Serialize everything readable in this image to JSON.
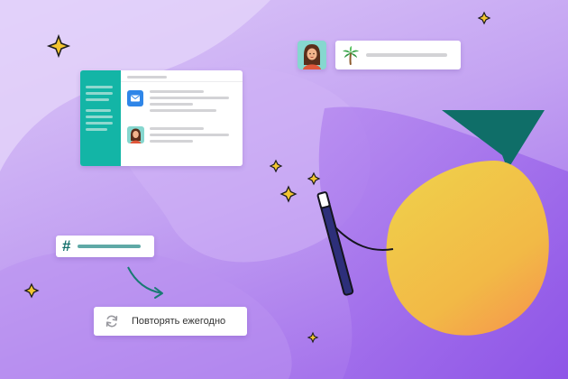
{
  "repeat_option": {
    "label": "Повторять ежегодно",
    "icon": "refresh-icon"
  },
  "chat_message": {
    "icon": "palm-tree-icon"
  },
  "channel": {
    "icon": "hashtag-icon",
    "symbol": "#"
  },
  "app_mock": {
    "items": [
      {
        "icon": "mail-app-icon"
      },
      {
        "icon": "avatar-icon"
      }
    ]
  },
  "colors": {
    "background_light": "#dcc6f7",
    "background_dark": "#9a5ee9",
    "sidebar": "#13b5a6",
    "accent_teal": "#0f6e68",
    "accent_yellow": "#f0c947",
    "wand": "#2d2f7a",
    "sparkle": "#f3c530"
  }
}
